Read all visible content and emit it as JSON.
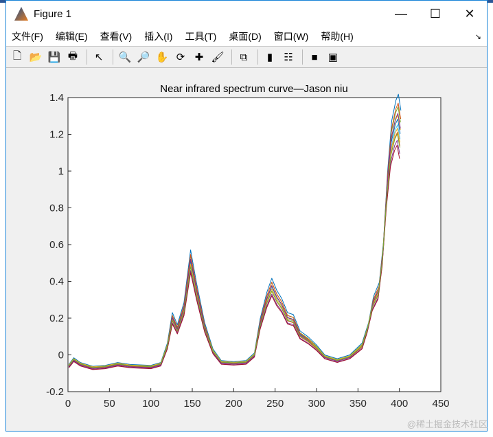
{
  "window": {
    "title": "Figure 1",
    "minimize": "—",
    "maximize": "☐",
    "close": "✕"
  },
  "menu": [
    "文件(F)",
    "编辑(E)",
    "查看(V)",
    "插入(I)",
    "工具(T)",
    "桌面(D)",
    "窗口(W)",
    "帮助(H)"
  ],
  "menu_overflow": "↘",
  "toolbar": [
    {
      "icon": "new-figure-icon",
      "glyph": "🗋"
    },
    {
      "icon": "open-icon",
      "glyph": "📂"
    },
    {
      "icon": "save-icon",
      "glyph": "💾"
    },
    {
      "icon": "print-icon",
      "glyph": "🖶"
    },
    "sep",
    {
      "icon": "pointer-icon",
      "glyph": "↖"
    },
    "sep",
    {
      "icon": "zoom-in-icon",
      "glyph": "🔍"
    },
    {
      "icon": "zoom-out-icon",
      "glyph": "🔎"
    },
    {
      "icon": "pan-icon",
      "glyph": "✋"
    },
    {
      "icon": "rotate-icon",
      "glyph": "⟳"
    },
    {
      "icon": "data-cursor-icon",
      "glyph": "✚"
    },
    {
      "icon": "brush-icon",
      "glyph": "🖌"
    },
    "sep",
    {
      "icon": "link-icon",
      "glyph": "⧉"
    },
    "sep",
    {
      "icon": "colorbar-icon",
      "glyph": "▮"
    },
    {
      "icon": "legend-icon",
      "glyph": "☷"
    },
    "sep",
    {
      "icon": "hide-plot-tools-icon",
      "glyph": "■"
    },
    {
      "icon": "show-plot-tools-icon",
      "glyph": "▣"
    }
  ],
  "watermark": "@稀土掘金技术社区",
  "chart_data": {
    "type": "line",
    "title": "Near infrared spectrum curve—Jason niu",
    "xlabel": "",
    "ylabel": "",
    "xlim": [
      0,
      450
    ],
    "ylim": [
      -0.2,
      1.4
    ],
    "xticks": [
      0,
      50,
      100,
      150,
      200,
      250,
      300,
      350,
      400,
      450
    ],
    "yticks": [
      -0.2,
      0,
      0.2,
      0.4,
      0.6,
      0.8,
      1,
      1.2,
      1.4
    ],
    "ytick_labels": [
      "-0.2",
      "0",
      "0.2",
      "0.4",
      "0.6",
      "0.8",
      "1",
      "1.2",
      "1.4"
    ],
    "grid": false,
    "base_x": [
      1,
      7,
      15,
      30,
      45,
      60,
      75,
      100,
      112,
      120,
      126,
      132,
      140,
      148,
      155,
      165,
      175,
      185,
      200,
      215,
      225,
      232,
      240,
      246,
      252,
      258,
      265,
      272,
      280,
      290,
      300,
      310,
      325,
      340,
      355,
      362,
      368,
      375,
      380,
      385,
      390,
      395,
      398,
      401
    ],
    "base_y": [
      -0.06,
      -0.025,
      -0.05,
      -0.07,
      -0.065,
      -0.05,
      -0.06,
      -0.065,
      -0.05,
      0.05,
      0.2,
      0.14,
      0.25,
      0.51,
      0.35,
      0.15,
      0.02,
      -0.04,
      -0.045,
      -0.04,
      0.0,
      0.17,
      0.3,
      0.37,
      0.31,
      0.27,
      0.2,
      0.19,
      0.11,
      0.08,
      0.04,
      -0.01,
      -0.03,
      -0.01,
      0.05,
      0.15,
      0.28,
      0.35,
      0.55,
      0.9,
      1.15,
      1.25,
      1.28,
      1.2
    ],
    "series": [
      {
        "color": "#0072bd",
        "scale": 1.1,
        "offset": 0.01
      },
      {
        "color": "#d95319",
        "scale": 0.95,
        "offset": -0.005
      },
      {
        "color": "#edb120",
        "scale": 1.02,
        "offset": 0.0
      },
      {
        "color": "#7e2f8e",
        "scale": 0.92,
        "offset": -0.01
      },
      {
        "color": "#77ac30",
        "scale": 1.05,
        "offset": 0.005
      },
      {
        "color": "#4dbeee",
        "scale": 0.98,
        "offset": -0.002
      },
      {
        "color": "#a2142f",
        "scale": 0.9,
        "offset": -0.012
      },
      {
        "color": "#0072bd",
        "scale": 1.0,
        "offset": 0.003
      },
      {
        "color": "#d95319",
        "scale": 1.07,
        "offset": 0.0
      },
      {
        "color": "#edb120",
        "scale": 0.96,
        "offset": 0.004
      },
      {
        "color": "#7e2f8e",
        "scale": 1.03,
        "offset": -0.004
      },
      {
        "color": "#77ac30",
        "scale": 0.94,
        "offset": 0.0
      }
    ]
  }
}
